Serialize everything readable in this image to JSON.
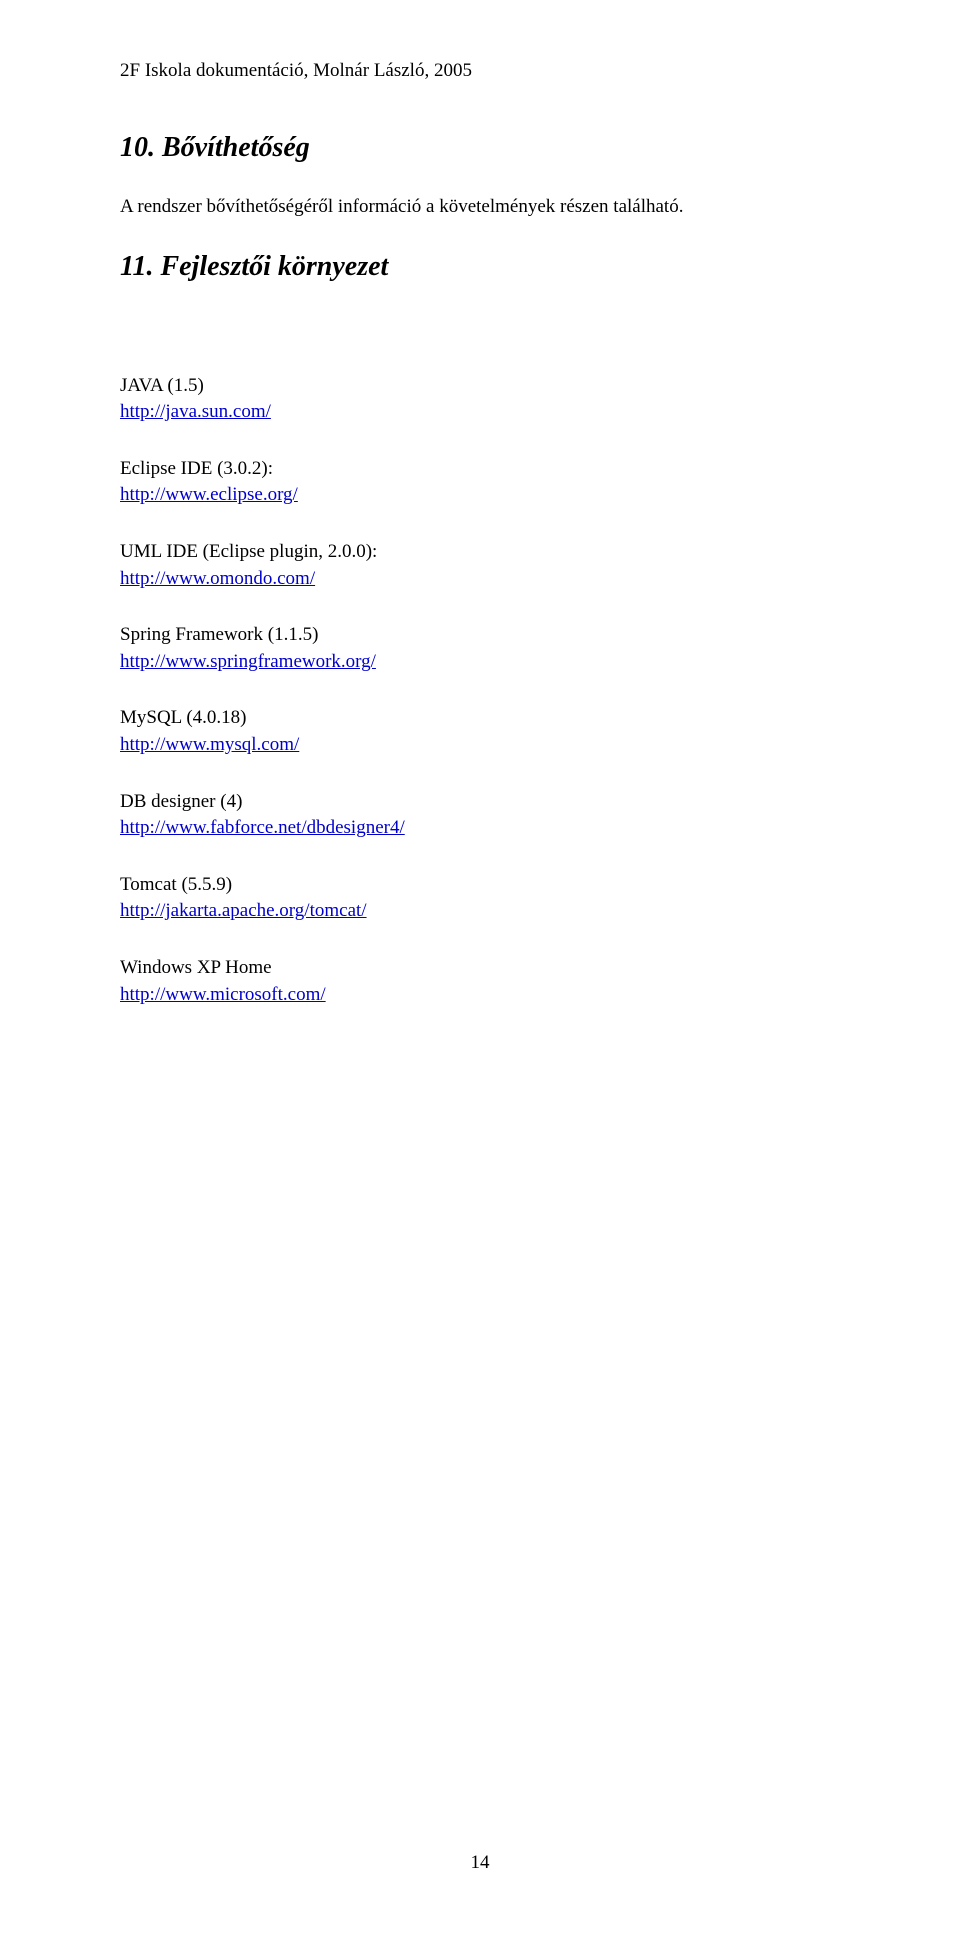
{
  "header": "2F Iskola dokumentáció, Molnár László, 2005",
  "section10": {
    "heading": "10. Bővíthetőség",
    "body": "A rendszer bővíthetőségéről információ a követelmények részen található."
  },
  "section11": {
    "heading": "11. Fejlesztői környezet",
    "items": [
      {
        "label": "JAVA (1.5)",
        "link": "http://java.sun.com/"
      },
      {
        "label": "Eclipse IDE (3.0.2):",
        "link": "http://www.eclipse.org/"
      },
      {
        "label": "UML IDE (Eclipse plugin, 2.0.0):",
        "link": "http://www.omondo.com/"
      },
      {
        "label": "Spring Framework (1.1.5)",
        "link": "http://www.springframework.org/"
      },
      {
        "label": "MySQL (4.0.18)",
        "link": "http://www.mysql.com/"
      },
      {
        "label": "DB designer (4)",
        "link": "http://www.fabforce.net/dbdesigner4/"
      },
      {
        "label": "Tomcat (5.5.9)",
        "link": "http://jakarta.apache.org/tomcat/"
      },
      {
        "label": "Windows XP Home",
        "link": "http://www.microsoft.com/"
      }
    ]
  },
  "pageNumber": "14"
}
